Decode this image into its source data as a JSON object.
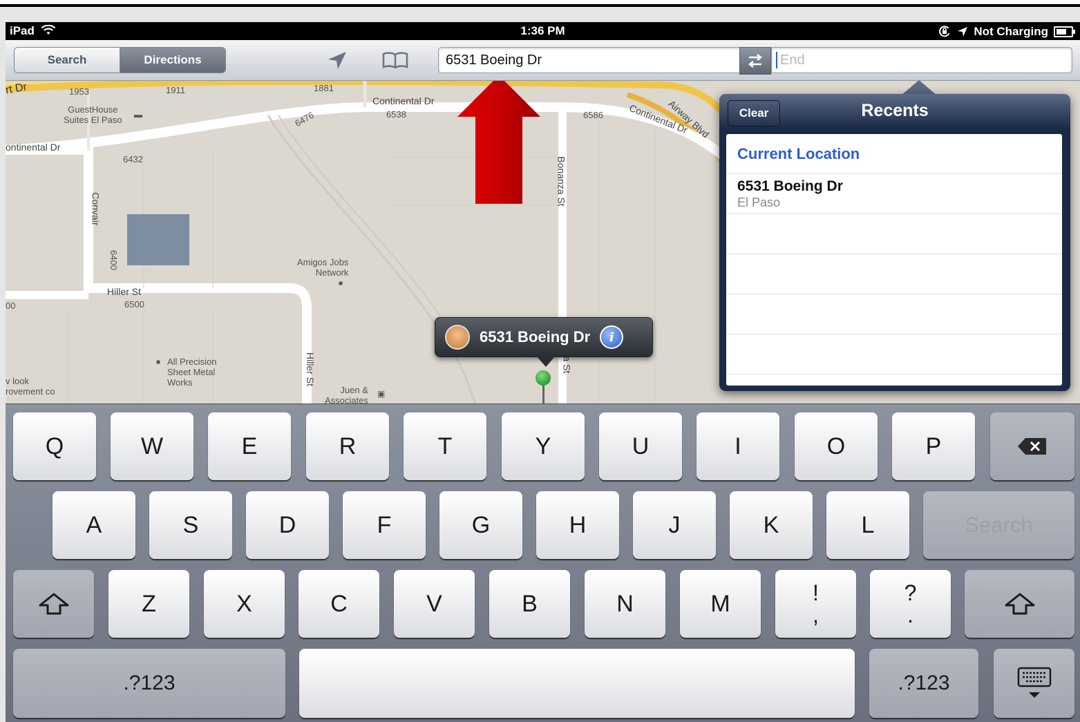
{
  "status_bar": {
    "device": "iPad",
    "time": "1:36 PM",
    "battery_text": "Not Charging"
  },
  "toolbar": {
    "search_tab": "Search",
    "directions_tab": "Directions",
    "start_value": "6531 Boeing Dr",
    "end_placeholder": "End"
  },
  "map": {
    "labels": {
      "airt_dr": "rt Dr",
      "n1953": "1953",
      "n1911": "1911",
      "n1881": "1881",
      "continental_dr_top": "Continental Dr",
      "n6538": "6538",
      "n6586": "6586",
      "continental_dr_diag": "Continental Dr",
      "airway_blvd": "Airway Blvd",
      "guesthouse": "GuestHouse\nSuites El Paso",
      "n6476": "6476",
      "continental_dr_left": "ontinental Dr",
      "n6432": "6432",
      "convair": "Convair",
      "bonanza_st": "Bonanza St",
      "n6400": "6400",
      "amigos": "Amigos Jobs\nNetwork",
      "hiller_st": "Hiller St",
      "n6500": "6500",
      "n00": "00",
      "hiller_st_v": "Hiller St",
      "all_precision": "All Precision\nSheet Metal\nWorks",
      "look": "v look\nrovement co",
      "juen": "Juen &\nAssociates",
      "st_vertical": "za St"
    },
    "callout_title": "6531 Boeing Dr",
    "callout_info": "i"
  },
  "recents": {
    "title": "Recents",
    "clear_label": "Clear",
    "current_location": "Current Location",
    "items": [
      {
        "title": "6531 Boeing Dr",
        "subtitle": "El Paso"
      }
    ]
  },
  "keyboard": {
    "row1": [
      "Q",
      "W",
      "E",
      "R",
      "T",
      "Y",
      "U",
      "I",
      "O",
      "P"
    ],
    "row2": [
      "A",
      "S",
      "D",
      "F",
      "G",
      "H",
      "J",
      "K",
      "L"
    ],
    "search_key": "Search",
    "row3": [
      "Z",
      "X",
      "C",
      "V",
      "B",
      "N",
      "M"
    ],
    "punct1_top": "!",
    "punct1_bottom": ",",
    "punct2_top": "?",
    "punct2_bottom": ".",
    "numbers_key": ".?123"
  },
  "colors": {
    "accent_blue": "#2e5dd8",
    "annotation_arrow": "#d40000"
  }
}
